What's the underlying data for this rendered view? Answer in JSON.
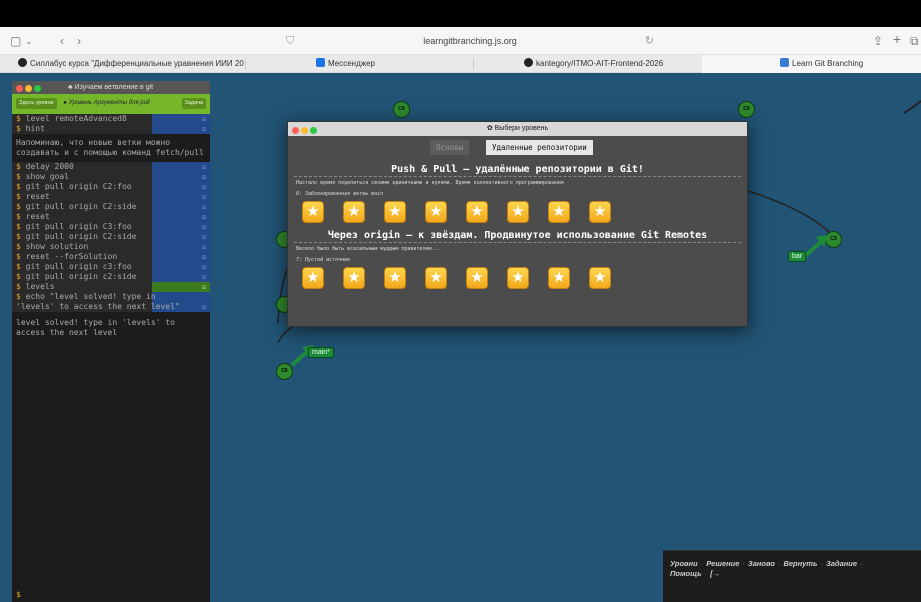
{
  "browser": {
    "url": "learngitbranching.js.org",
    "tabs": [
      {
        "label": "Силлабус курса \"Дифференциальные уравнения ИИИ 2026\"",
        "favicon_color": "#222222"
      },
      {
        "label": "Мессенджер",
        "favicon_color": "#1a73e8"
      },
      {
        "label": "kantegory/ITMO-AIT-Frontend-2026",
        "favicon_color": "#222222"
      },
      {
        "label": "Learn Git Branching",
        "favicon_color": "#3a7bd5"
      }
    ]
  },
  "terminal": {
    "title": "Изучаем ветвление в git",
    "btn_all_levels": "Здесь уровни",
    "level_prefix": "Уровень",
    "level_name": "Аргументы для pull",
    "btn_task": "Задача",
    "commands_top": [
      {
        "text": "level remoteAdvanced8",
        "done": true
      },
      {
        "text": "hint",
        "done": true
      }
    ],
    "hint_text": "Напоминаю, что новые ветки можно создавать и с помощью команд fetch/pull",
    "commands": [
      {
        "text": "delay 2000",
        "done": true
      },
      {
        "text": "show goal",
        "done": true
      },
      {
        "text": "git pull origin C2:foo",
        "done": true
      },
      {
        "text": "reset",
        "done": true
      },
      {
        "text": "git pull origin C2:side",
        "done": true
      },
      {
        "text": "reset",
        "done": true
      },
      {
        "text": "git pull origin C3:foo",
        "done": true
      },
      {
        "text": "git pull origin C2:side",
        "done": true
      },
      {
        "text": "show solution",
        "done": true
      },
      {
        "text": "reset --forSolution",
        "done": true
      },
      {
        "text": "git pull origin c3:foo",
        "done": true
      },
      {
        "text": "git pull origin c2:side",
        "done": true
      },
      {
        "text": "levels",
        "done": true
      }
    ],
    "echo_command": "echo \"level solved! type in 'levels' to access the next level\"",
    "echo_output": "level solved! type in 'levels' to access the next level",
    "prompt": "$"
  },
  "graph": {
    "nodes": [
      "C0",
      "C6",
      "C0",
      "C3"
    ],
    "branches": [
      "main*",
      "bar"
    ]
  },
  "modal": {
    "title": "Выбери уровень",
    "tab_basic": "Основы",
    "tab_remote": "Удаленные репозитории",
    "section1": {
      "title": "Push & Pull – удалённые репозитории в Git!",
      "desc": "Настало время поделиться своими единичками и нулями. Время коллективного программирования",
      "subtitle": "8: Заблокированная ветвь main",
      "star_count": 8
    },
    "section2": {
      "title": "Через origin – к звёздам. Продвинутое использование Git Remotes",
      "desc": "Весело было быть всесильным мудрым правителем...",
      "subtitle": "7: Пустой источник",
      "star_count": 8
    }
  },
  "command_bar": {
    "items": [
      "Уровни",
      "Решение",
      "Заново",
      "Вернуть",
      "Задание",
      "Помощь"
    ],
    "separator": "·",
    "exit_icon": "exit-icon"
  },
  "colors": {
    "terminal_green": "#75b728",
    "canvas_blue": "#225475",
    "star_gold": "#f2a81b"
  }
}
